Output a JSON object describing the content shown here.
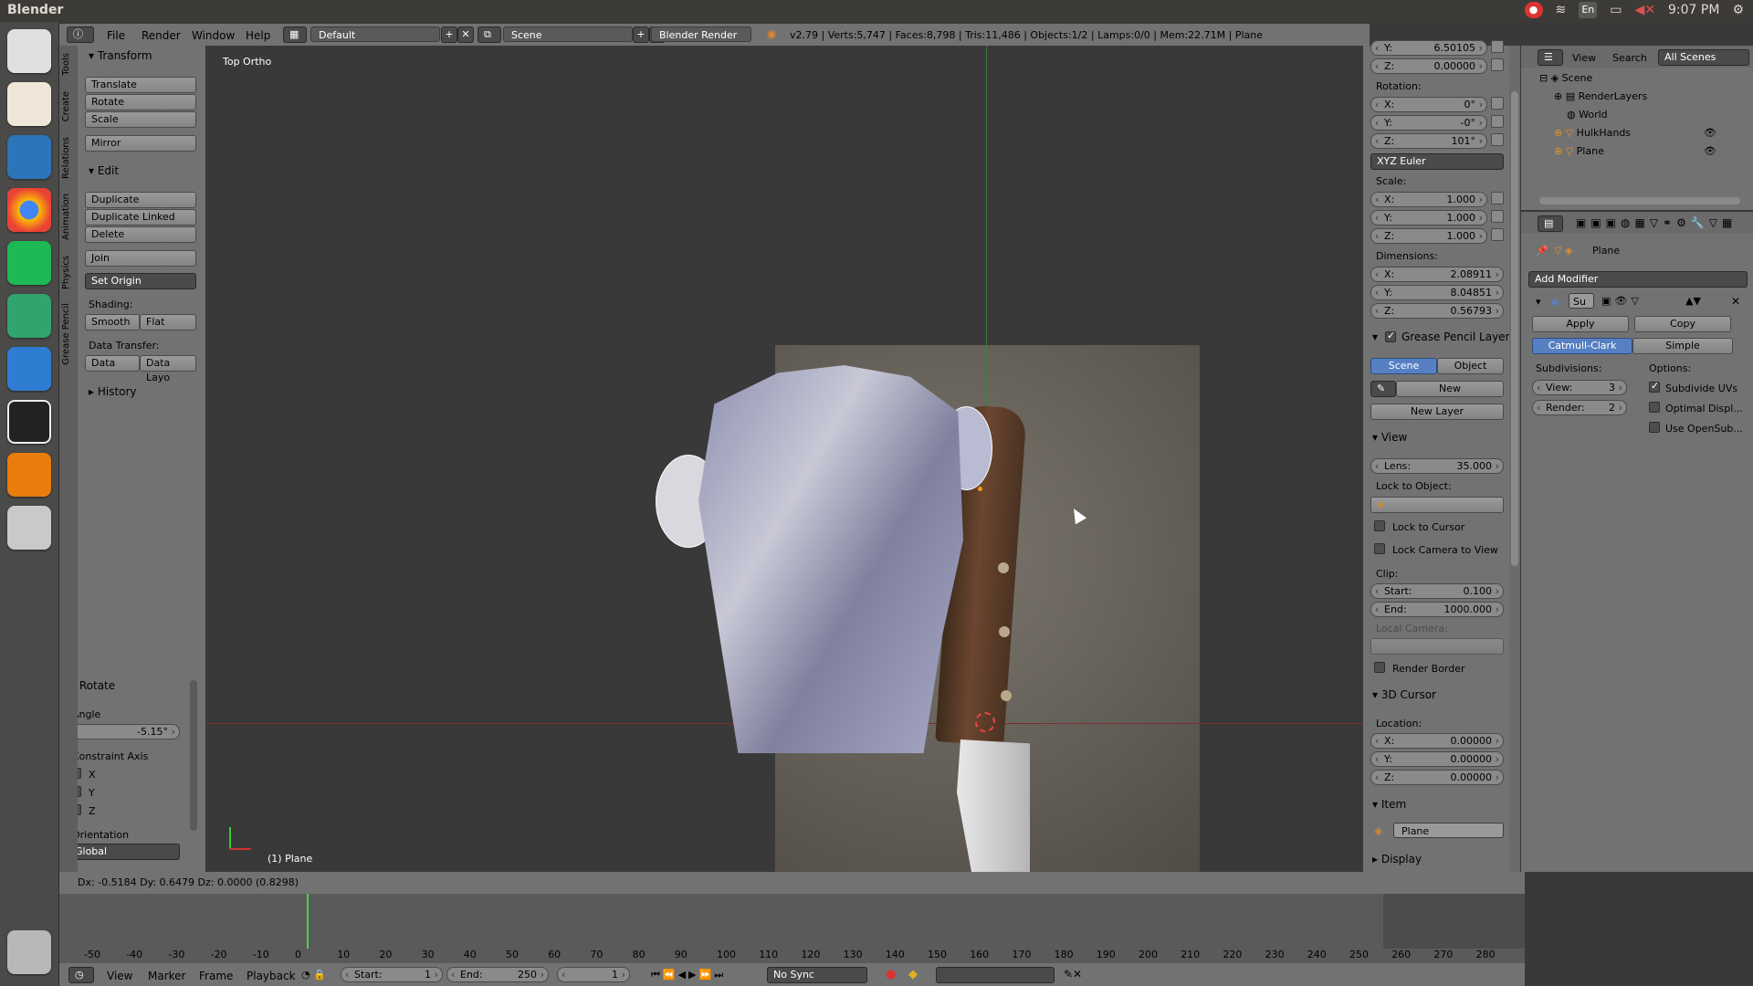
{
  "os": {
    "app_title": "Blender",
    "keyboard_layout": "En",
    "clock": "9:07 PM"
  },
  "header": {
    "menus": [
      "File",
      "Render",
      "Window",
      "Help"
    ],
    "layout": "Default",
    "scene": "Scene",
    "engine": "Blender Render",
    "stats": "v2.79 | Verts:5,747 | Faces:8,798 | Tris:11,486 | Objects:1/2 | Lamps:0/0 | Mem:22.71M | Plane"
  },
  "tool_tabs": [
    "Tools",
    "Create",
    "Relations",
    "Animation",
    "Physics",
    "Grease Pencil"
  ],
  "toolshelf": {
    "transform_title": "Transform",
    "translate": "Translate",
    "rotate": "Rotate",
    "scale": "Scale",
    "mirror": "Mirror",
    "edit_title": "Edit",
    "duplicate": "Duplicate",
    "duplicate_linked": "Duplicate Linked",
    "delete": "Delete",
    "join": "Join",
    "set_origin": "Set Origin",
    "shading_label": "Shading:",
    "smooth": "Smooth",
    "flat": "Flat",
    "data_transfer_label": "Data Transfer:",
    "data": "Data",
    "data_layo": "Data Layo",
    "history_title": "History"
  },
  "operator": {
    "title": "Rotate",
    "angle_label": "Angle",
    "angle_value": "-5.15°",
    "constraint_label": "Constraint Axis",
    "axis_x": "X",
    "axis_y": "Y",
    "axis_z": "Z",
    "orientation_label": "Orientation",
    "orientation_value": "Global"
  },
  "viewport": {
    "view_name": "Top Ortho",
    "object_label": "(1) Plane"
  },
  "npanel": {
    "loc_y_label": "Y:",
    "loc_y": "6.50105",
    "loc_z_label": "Z:",
    "loc_z": "0.00000",
    "rotation_label": "Rotation:",
    "rot_x_label": "X:",
    "rot_x": "0°",
    "rot_y_label": "Y:",
    "rot_y": "-0°",
    "rot_z_label": "Z:",
    "rot_z": "101°",
    "rotation_mode": "XYZ Euler",
    "scale_label": "Scale:",
    "scale_x_label": "X:",
    "scale_x": "1.000",
    "scale_y_label": "Y:",
    "scale_y": "1.000",
    "scale_z_label": "Z:",
    "scale_z": "1.000",
    "dimensions_label": "Dimensions:",
    "dim_x_label": "X:",
    "dim_x": "2.08911",
    "dim_y_label": "Y:",
    "dim_y": "8.04851",
    "dim_z_label": "Z:",
    "dim_z": "0.56793",
    "gp_title": "Grease Pencil Layers",
    "gp_scene": "Scene",
    "gp_object": "Object",
    "gp_new": "New",
    "gp_new_layer": "New Layer",
    "view_title": "View",
    "lens_label": "Lens:",
    "lens": "35.000",
    "lock_object_label": "Lock to Object:",
    "lock_cursor": "Lock to Cursor",
    "lock_camera": "Lock Camera to View",
    "clip_label": "Clip:",
    "clip_start_label": "Start:",
    "clip_start": "0.100",
    "clip_end_label": "End:",
    "clip_end": "1000.000",
    "local_camera_label": "Local Camera:",
    "render_border": "Render Border",
    "cursor_title": "3D Cursor",
    "location_label": "Location:",
    "cur_x_label": "X:",
    "cur_x": "0.00000",
    "cur_y_label": "Y:",
    "cur_y": "0.00000",
    "cur_z_label": "Z:",
    "cur_z": "0.00000",
    "item_title": "Item",
    "item_name": "Plane",
    "display_title": "Display"
  },
  "outliner": {
    "view": "View",
    "search": "Search",
    "filter": "All Scenes",
    "items": [
      "Scene",
      "RenderLayers",
      "World",
      "HulkHands",
      "Plane"
    ]
  },
  "properties": {
    "breadcrumb": "Plane",
    "add_modifier": "Add Modifier",
    "mod_name": "Su",
    "apply": "Apply",
    "copy": "Copy",
    "catmull": "Catmull-Clark",
    "simple": "Simple",
    "subdivisions_label": "Subdivisions:",
    "options_label": "Options:",
    "view_label": "View:",
    "view_value": "3",
    "render_label": "Render:",
    "render_value": "2",
    "subdivide_uvs": "Subdivide UVs",
    "optimal_display": "Optimal Displ...",
    "use_opensubdiv": "Use OpenSub..."
  },
  "status": {
    "text": "Dx: -0.5184  Dy: 0.6479  Dz: 0.0000 (0.8298)"
  },
  "timeline": {
    "ticks": [
      "-50",
      "-40",
      "-30",
      "-20",
      "-10",
      "0",
      "10",
      "20",
      "30",
      "40",
      "50",
      "60",
      "70",
      "80",
      "90",
      "100",
      "110",
      "120",
      "130",
      "140",
      "150",
      "160",
      "170",
      "180",
      "190",
      "200",
      "210",
      "220",
      "230",
      "240",
      "250",
      "260",
      "270",
      "280"
    ],
    "current_frame": 1
  },
  "time_header": {
    "menus": [
      "View",
      "Marker",
      "Frame",
      "Playback"
    ],
    "start_label": "Start:",
    "start": "1",
    "end_label": "End:",
    "end": "250",
    "current": "1",
    "sync": "No Sync"
  }
}
